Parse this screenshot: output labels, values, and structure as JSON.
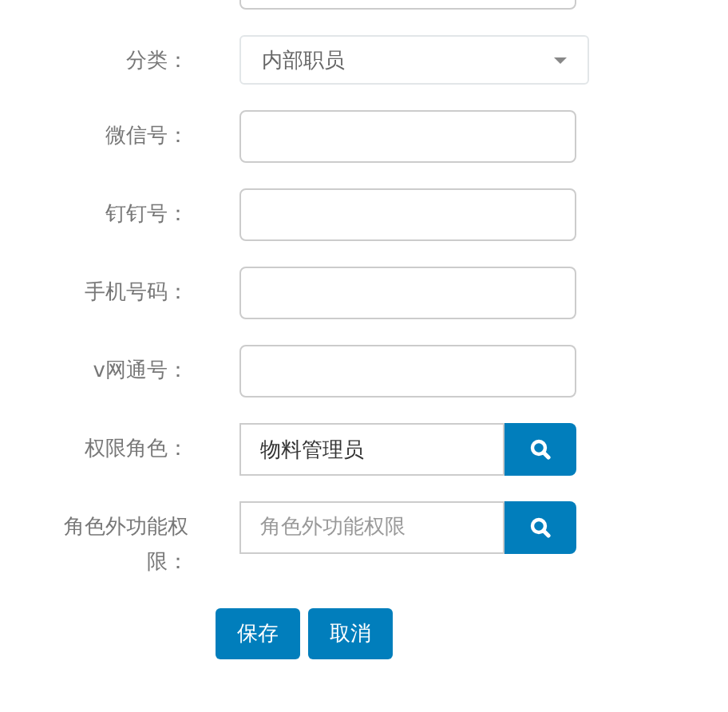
{
  "rows": [
    {
      "kind": "text"
    },
    {
      "kind": "select",
      "label": "分类：",
      "value": "内部职员"
    },
    {
      "kind": "text",
      "label": "微信号："
    },
    {
      "kind": "text",
      "label": "钉钉号："
    },
    {
      "kind": "text",
      "label": "手机号码："
    },
    {
      "kind": "text",
      "label": "v网通号："
    },
    {
      "kind": "search",
      "label": "权限角色：",
      "value": "物料管理员"
    },
    {
      "kind": "search",
      "label": "角色外功能权限：",
      "placeholder": "角色外功能权限"
    }
  ],
  "buttons": [
    "保存",
    "取消"
  ]
}
